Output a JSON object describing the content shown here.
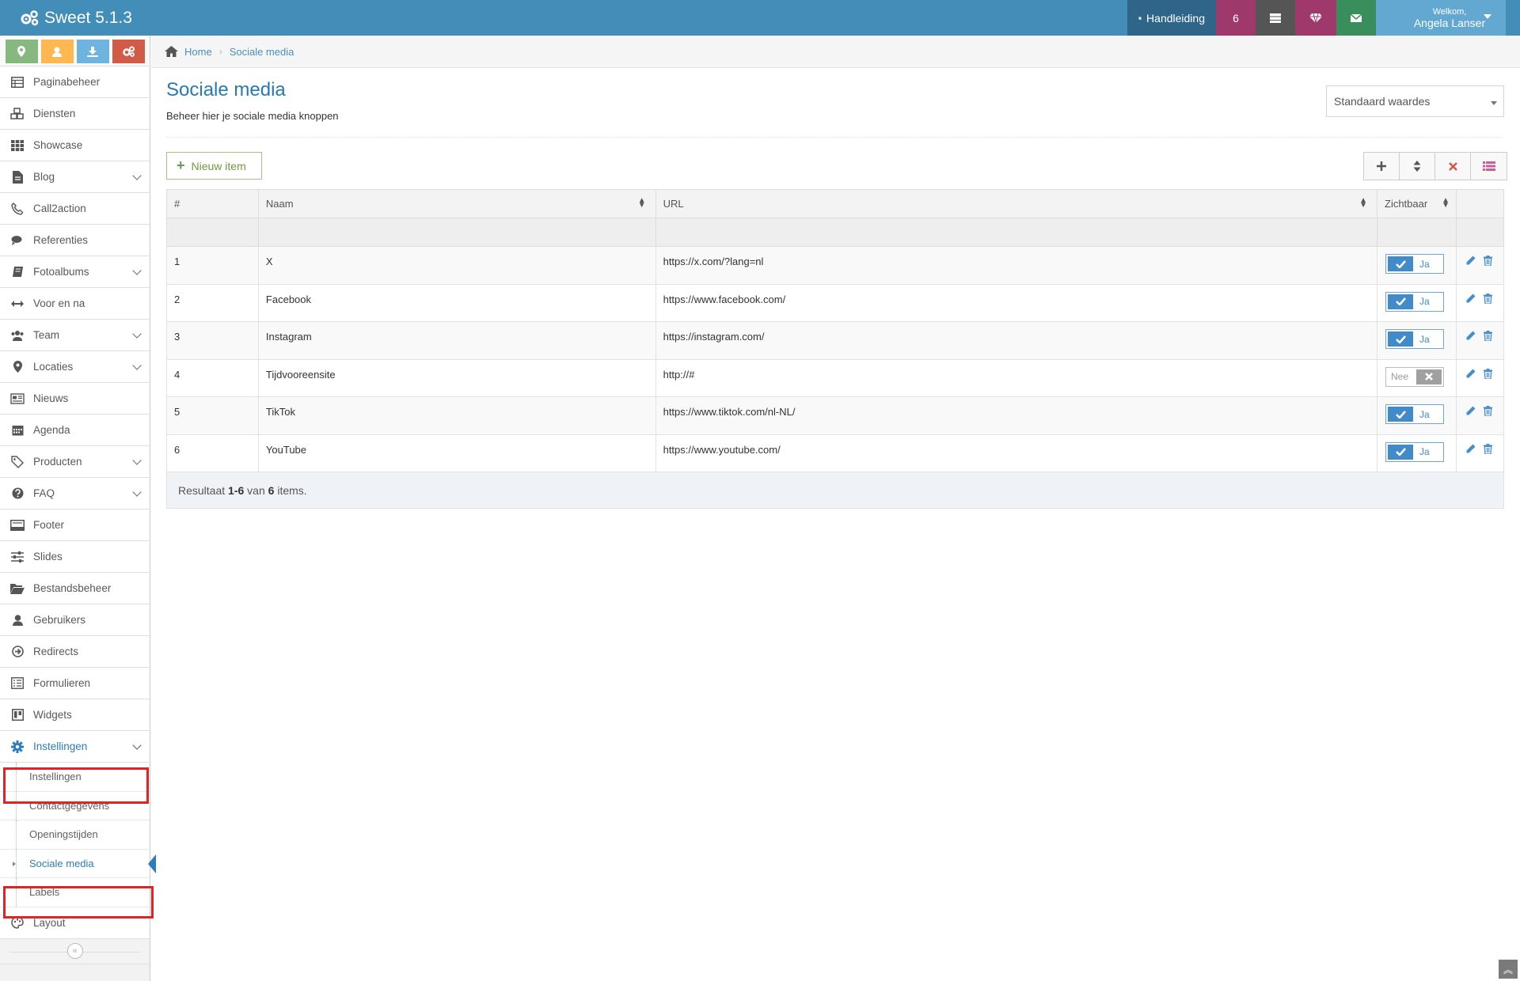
{
  "app": {
    "title": "Sweet 5.1.3"
  },
  "topnav": {
    "manual": "Handleiding",
    "count": "6",
    "welcome": "Welkom,",
    "user": "Angela Lanser"
  },
  "sidebar": {
    "items": [
      {
        "label": "Paginabeheer",
        "icon": "table-icon"
      },
      {
        "label": "Diensten",
        "icon": "cubes-icon"
      },
      {
        "label": "Showcase",
        "icon": "grid-icon"
      },
      {
        "label": "Blog",
        "icon": "file-icon",
        "chevron": true
      },
      {
        "label": "Call2action",
        "icon": "phone-icon"
      },
      {
        "label": "Referenties",
        "icon": "comments-icon"
      },
      {
        "label": "Fotoalbums",
        "icon": "book-icon",
        "chevron": true
      },
      {
        "label": "Voor en na",
        "icon": "arrows-h-icon"
      },
      {
        "label": "Team",
        "icon": "users-icon",
        "chevron": true
      },
      {
        "label": "Locaties",
        "icon": "map-marker-icon",
        "chevron": true
      },
      {
        "label": "Nieuws",
        "icon": "newspaper-icon"
      },
      {
        "label": "Agenda",
        "icon": "calendar-icon"
      },
      {
        "label": "Producten",
        "icon": "tags-icon",
        "chevron": true
      },
      {
        "label": "FAQ",
        "icon": "question-icon",
        "chevron": true
      },
      {
        "label": "Footer",
        "icon": "footer-icon"
      },
      {
        "label": "Slides",
        "icon": "sliders-icon"
      },
      {
        "label": "Bestandsbeheer",
        "icon": "folder-open-icon"
      },
      {
        "label": "Gebruikers",
        "icon": "user-icon"
      },
      {
        "label": "Redirects",
        "icon": "arrow-circle-icon"
      },
      {
        "label": "Formulieren",
        "icon": "list-alt-icon"
      },
      {
        "label": "Widgets",
        "icon": "trello-icon"
      },
      {
        "label": "Instellingen",
        "icon": "gear-icon",
        "chevron": true
      }
    ],
    "submenu": [
      "Instellingen",
      "Contactgegevens",
      "Openingstijden",
      "Sociale media",
      "Labels"
    ],
    "last": "Layout"
  },
  "breadcrumb": {
    "home": "Home",
    "current": "Sociale media"
  },
  "page": {
    "title": "Sociale media",
    "subtitle": "Beheer hier je sociale media knoppen",
    "select_value": "Standaard waardes",
    "new_item": "Nieuw item"
  },
  "table": {
    "headers": {
      "num": "#",
      "name": "Naam",
      "url": "URL",
      "visible": "Zichtbaar"
    },
    "rows": [
      {
        "num": "1",
        "name": "X",
        "url": "https://x.com/?lang=nl",
        "visible": "Ja",
        "on": true
      },
      {
        "num": "2",
        "name": "Facebook",
        "url": "https://www.facebook.com/",
        "visible": "Ja",
        "on": true
      },
      {
        "num": "3",
        "name": "Instagram",
        "url": "https://instagram.com/",
        "visible": "Ja",
        "on": true
      },
      {
        "num": "4",
        "name": "Tijdvooreensite",
        "url": "http://#",
        "visible": "Nee",
        "on": false
      },
      {
        "num": "5",
        "name": "TikTok",
        "url": "https://www.tiktok.com/nl-NL/",
        "visible": "Ja",
        "on": true
      },
      {
        "num": "6",
        "name": "YouTube",
        "url": "https://www.youtube.com/",
        "visible": "Ja",
        "on": true
      }
    ],
    "summary": {
      "prefix": "Resultaat",
      "range": "1-6",
      "mid": "van",
      "total": "6",
      "suffix": "items."
    }
  },
  "colors": {
    "topbar": "#438eb9",
    "accent": "#2b7dbc",
    "highlight": "#e02424"
  }
}
